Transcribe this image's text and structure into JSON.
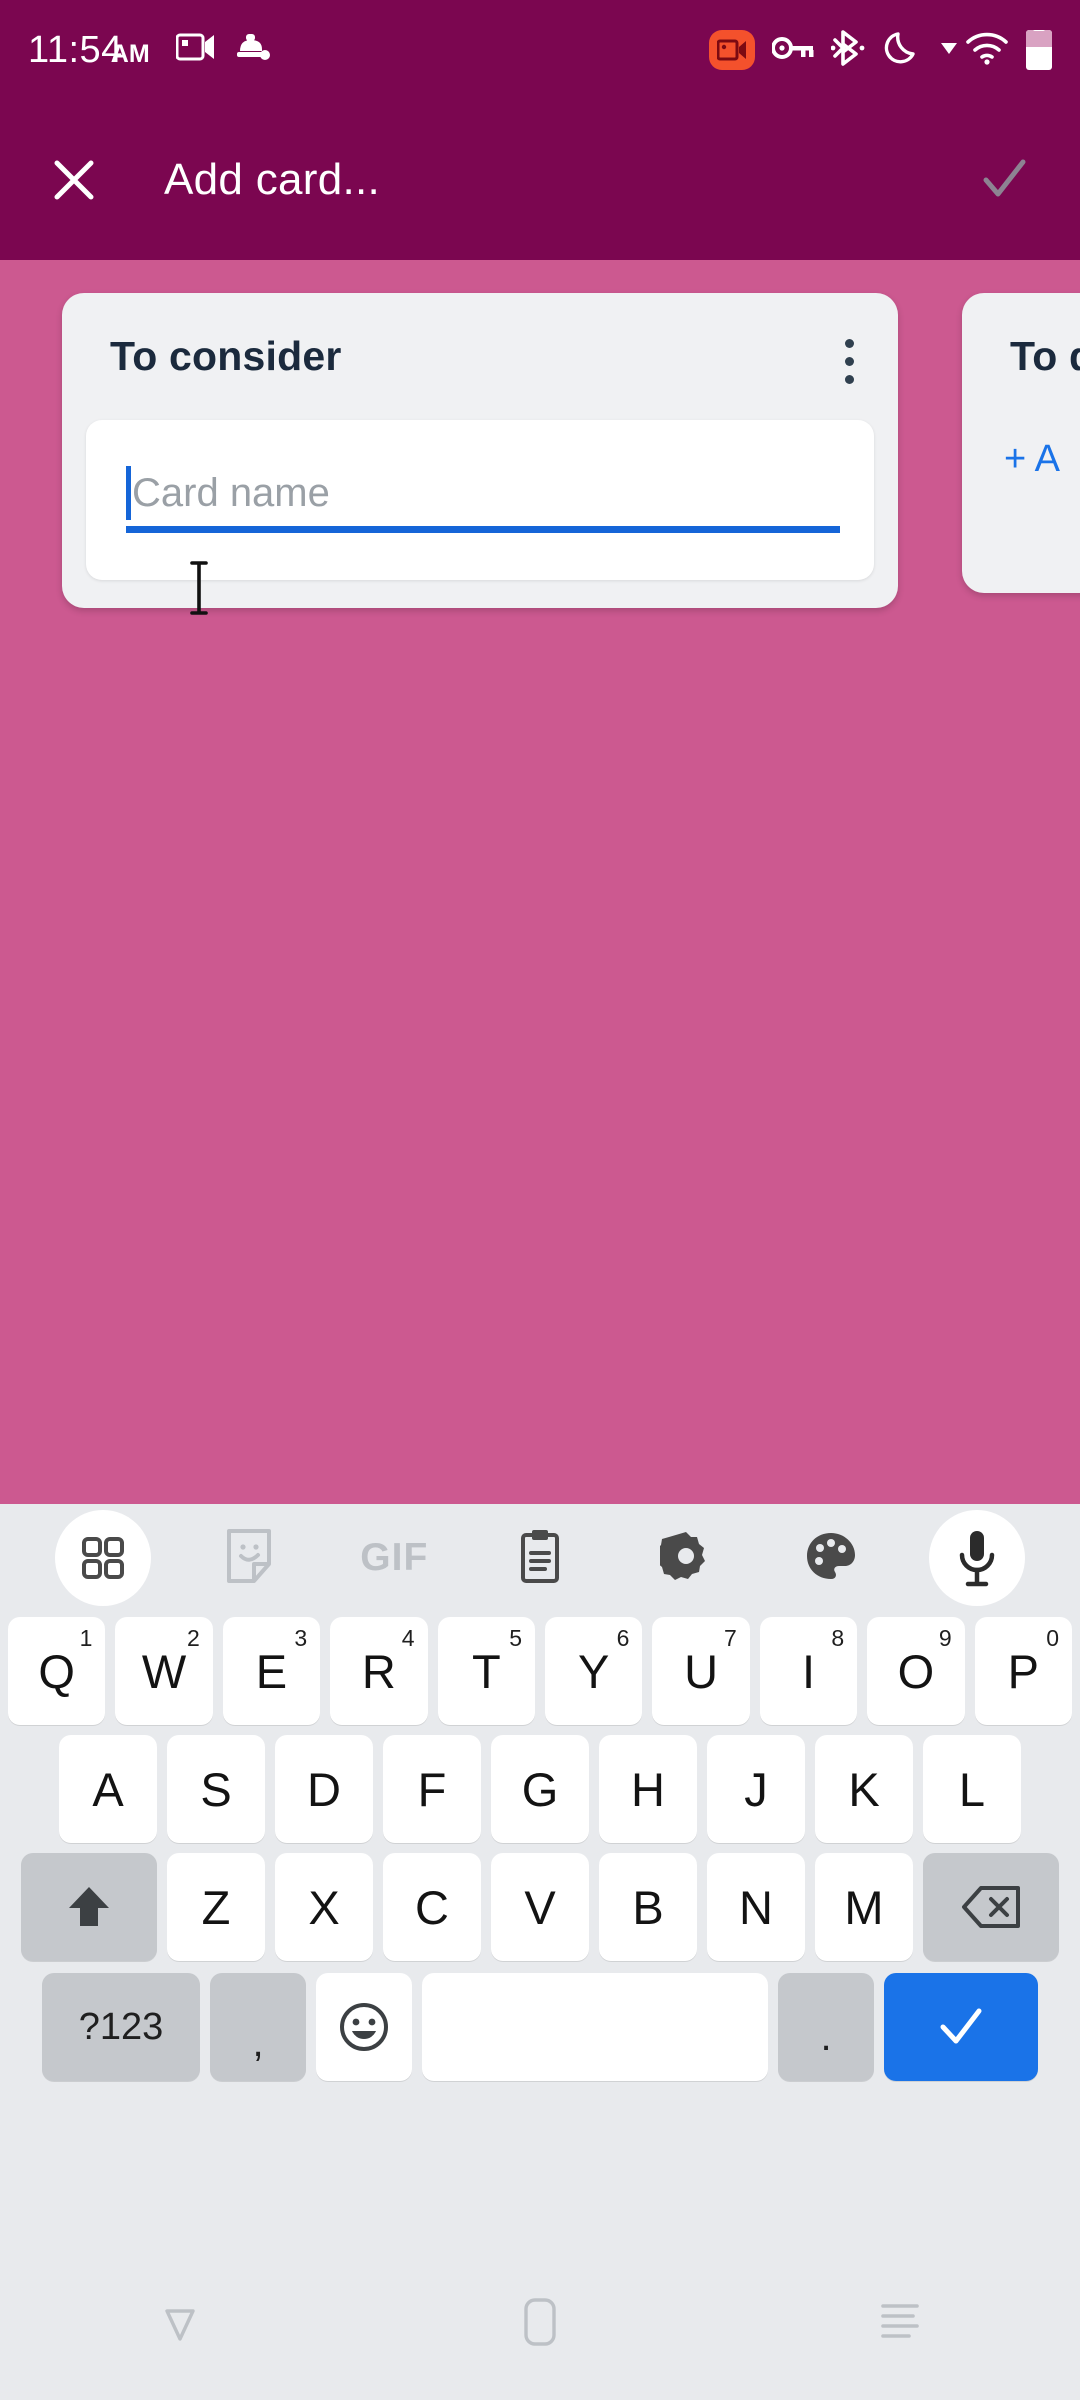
{
  "status_bar": {
    "time": "11:54",
    "ampm": "AM",
    "icons_left": [
      "screen-cast-icon",
      "vpn-lock-icon"
    ],
    "icons_right": [
      "screen-record-icon",
      "vpn-key-icon",
      "bluetooth-icon",
      "do-not-disturb-moon-icon",
      "signal-dropdown-icon",
      "wifi-icon",
      "battery-icon"
    ]
  },
  "app_bar": {
    "close_label": "close-icon",
    "title": "Add card...",
    "confirm_label": "check-icon",
    "background": "#7B0650",
    "confirm_color": "#8D8392"
  },
  "board": {
    "background": "#CC5990",
    "columns": [
      {
        "title": "To consider",
        "overflow_label": "more-options",
        "card_input": {
          "placeholder": "Card name",
          "value": "",
          "caret_color": "#1565D8",
          "underline_color": "#1565D8"
        }
      },
      {
        "title": "To d",
        "add_card_label": "+ A"
      }
    ]
  },
  "keyboard": {
    "toolbar": [
      {
        "name": "apps-grid-icon",
        "label": ""
      },
      {
        "name": "sticker-icon",
        "label": ""
      },
      {
        "name": "gif-icon",
        "label": "GIF"
      },
      {
        "name": "clipboard-icon",
        "label": ""
      },
      {
        "name": "settings-gear-icon",
        "label": ""
      },
      {
        "name": "theme-palette-icon",
        "label": ""
      },
      {
        "name": "microphone-icon",
        "label": ""
      }
    ],
    "row1": [
      {
        "letter": "Q",
        "num": "1"
      },
      {
        "letter": "W",
        "num": "2"
      },
      {
        "letter": "E",
        "num": "3"
      },
      {
        "letter": "R",
        "num": "4"
      },
      {
        "letter": "T",
        "num": "5"
      },
      {
        "letter": "Y",
        "num": "6"
      },
      {
        "letter": "U",
        "num": "7"
      },
      {
        "letter": "I",
        "num": "8"
      },
      {
        "letter": "O",
        "num": "9"
      },
      {
        "letter": "P",
        "num": "0"
      }
    ],
    "row2": [
      {
        "letter": "A"
      },
      {
        "letter": "S"
      },
      {
        "letter": "D"
      },
      {
        "letter": "F"
      },
      {
        "letter": "G"
      },
      {
        "letter": "H"
      },
      {
        "letter": "J"
      },
      {
        "letter": "K"
      },
      {
        "letter": "L"
      }
    ],
    "row3": [
      {
        "letter": "Z"
      },
      {
        "letter": "X"
      },
      {
        "letter": "C"
      },
      {
        "letter": "V"
      },
      {
        "letter": "B"
      },
      {
        "letter": "N"
      },
      {
        "letter": "M"
      }
    ],
    "shift_label": "shift-icon",
    "backspace_label": "backspace-icon",
    "symbols_label": "?123",
    "comma_label": ",",
    "emoji_label": "emoji-icon",
    "space_label": "",
    "period_label": ".",
    "enter_label": "enter-check-icon",
    "enter_color": "#1A73E8"
  },
  "nav_bar": {
    "back_label": "back-icon",
    "home_label": "home-icon",
    "recents_label": "recents-icon"
  }
}
